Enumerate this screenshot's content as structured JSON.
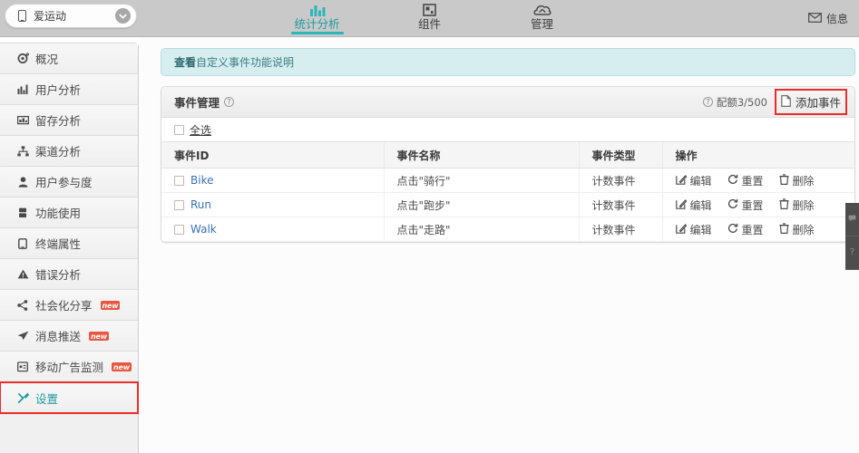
{
  "topbar": {
    "app_selector": {
      "name": "爱运动",
      "phone_icon": "phone-icon",
      "chevron_icon": "chevron-down-icon"
    },
    "nav": [
      {
        "label": "统计分析",
        "icon": "bar-chart-icon",
        "active": true
      },
      {
        "label": "组件",
        "icon": "widget-icon",
        "active": false
      },
      {
        "label": "管理",
        "icon": "cloud-icon",
        "active": false
      }
    ],
    "messages": {
      "label": "信息",
      "icon": "envelope-icon"
    }
  },
  "sidebar": {
    "items": [
      {
        "label": "概况",
        "icon": "gear-icon",
        "badge": ""
      },
      {
        "label": "用户分析",
        "icon": "bar-chart-icon",
        "badge": ""
      },
      {
        "label": "留存分析",
        "icon": "grid-icon",
        "badge": ""
      },
      {
        "label": "渠道分析",
        "icon": "sitemap-icon",
        "badge": ""
      },
      {
        "label": "用户参与度",
        "icon": "user-icon",
        "badge": ""
      },
      {
        "label": "功能使用",
        "icon": "server-icon",
        "badge": ""
      },
      {
        "label": "终端属性",
        "icon": "device-icon",
        "badge": ""
      },
      {
        "label": "错误分析",
        "icon": "warning-icon",
        "badge": ""
      },
      {
        "label": "社会化分享",
        "icon": "share-icon",
        "badge": "new"
      },
      {
        "label": "消息推送",
        "icon": "send-icon",
        "badge": "new"
      },
      {
        "label": "移动广告监测",
        "icon": "monitor-icon",
        "badge": "new"
      },
      {
        "label": "设置",
        "icon": "tools-icon",
        "badge": ""
      }
    ]
  },
  "notice": {
    "strong": "查看",
    "text": "自定义事件功能说明"
  },
  "panel": {
    "title": "事件管理",
    "help_icon": "question-icon",
    "quota": {
      "icon": "question-icon",
      "label": "配额3/500"
    },
    "add_button": {
      "label": "添加事件",
      "icon": "document-icon"
    },
    "select_all": {
      "label": "全选",
      "checked": false
    },
    "columns": [
      "事件ID",
      "事件名称",
      "事件类型",
      "操作"
    ],
    "rows": [
      {
        "id": "Bike",
        "name": "点击\"骑行\"",
        "type": "计数事件",
        "checked": false,
        "actions": [
          {
            "label": "编辑",
            "icon": "edit-icon"
          },
          {
            "label": "重置",
            "icon": "reset-icon"
          },
          {
            "label": "删除",
            "icon": "trash-icon"
          }
        ]
      },
      {
        "id": "Run",
        "name": "点击\"跑步\"",
        "type": "计数事件",
        "checked": false,
        "actions": [
          {
            "label": "编辑",
            "icon": "edit-icon"
          },
          {
            "label": "重置",
            "icon": "reset-icon"
          },
          {
            "label": "删除",
            "icon": "trash-icon"
          }
        ]
      },
      {
        "id": "Walk",
        "name": "点击\"走路\"",
        "type": "计数事件",
        "checked": false,
        "actions": [
          {
            "label": "编辑",
            "icon": "edit-icon"
          },
          {
            "label": "重置",
            "icon": "reset-icon"
          },
          {
            "label": "删除",
            "icon": "trash-icon"
          }
        ]
      }
    ]
  },
  "help_tabs": [
    {
      "icon": "chat-icon",
      "glyph": "💬"
    },
    {
      "icon": "question-icon",
      "glyph": "?"
    }
  ],
  "colors": {
    "accent": "#2bb7b9",
    "link": "#3b6fb6",
    "highlight": "#ee2b2b",
    "notice_bg": "#d6eef0",
    "badge": "#e8563f"
  }
}
